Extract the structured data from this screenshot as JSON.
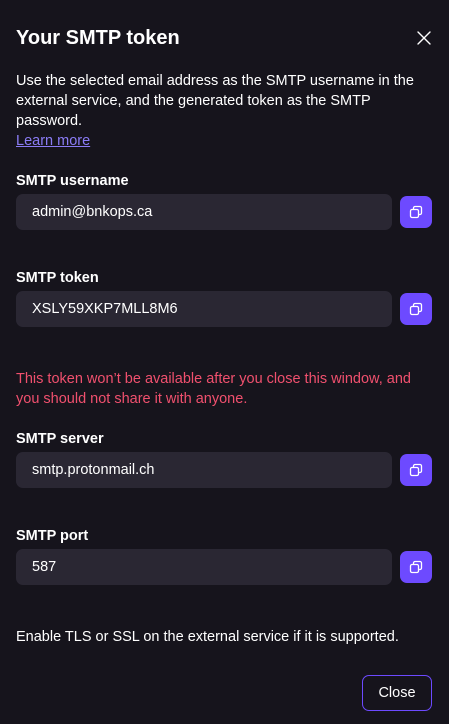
{
  "modal": {
    "title": "Your SMTP token",
    "description": "Use the selected email address as the SMTP username in the external service, and the generated token as the SMTP password.",
    "learn_more": "Learn more"
  },
  "fields": {
    "username": {
      "label": "SMTP username",
      "value": "admin@bnkops.ca"
    },
    "token": {
      "label": "SMTP token",
      "value": "XSLY59XKP7MLL8M6"
    },
    "server": {
      "label": "SMTP server",
      "value": "smtp.protonmail.ch"
    },
    "port": {
      "label": "SMTP port",
      "value": "587"
    }
  },
  "warning": "This token won’t be available after you close this window, and you should not share it with anyone.",
  "note": "Enable TLS or SSL on the external service if it is supported.",
  "buttons": {
    "close": "Close"
  },
  "colors": {
    "background": "#16141c",
    "input_bg": "#2a2733",
    "accent": "#6d4aff",
    "link": "#8b7cf6",
    "warning": "#f0506e"
  },
  "icons": {
    "close": "close-icon",
    "copy": "copy-icon"
  }
}
